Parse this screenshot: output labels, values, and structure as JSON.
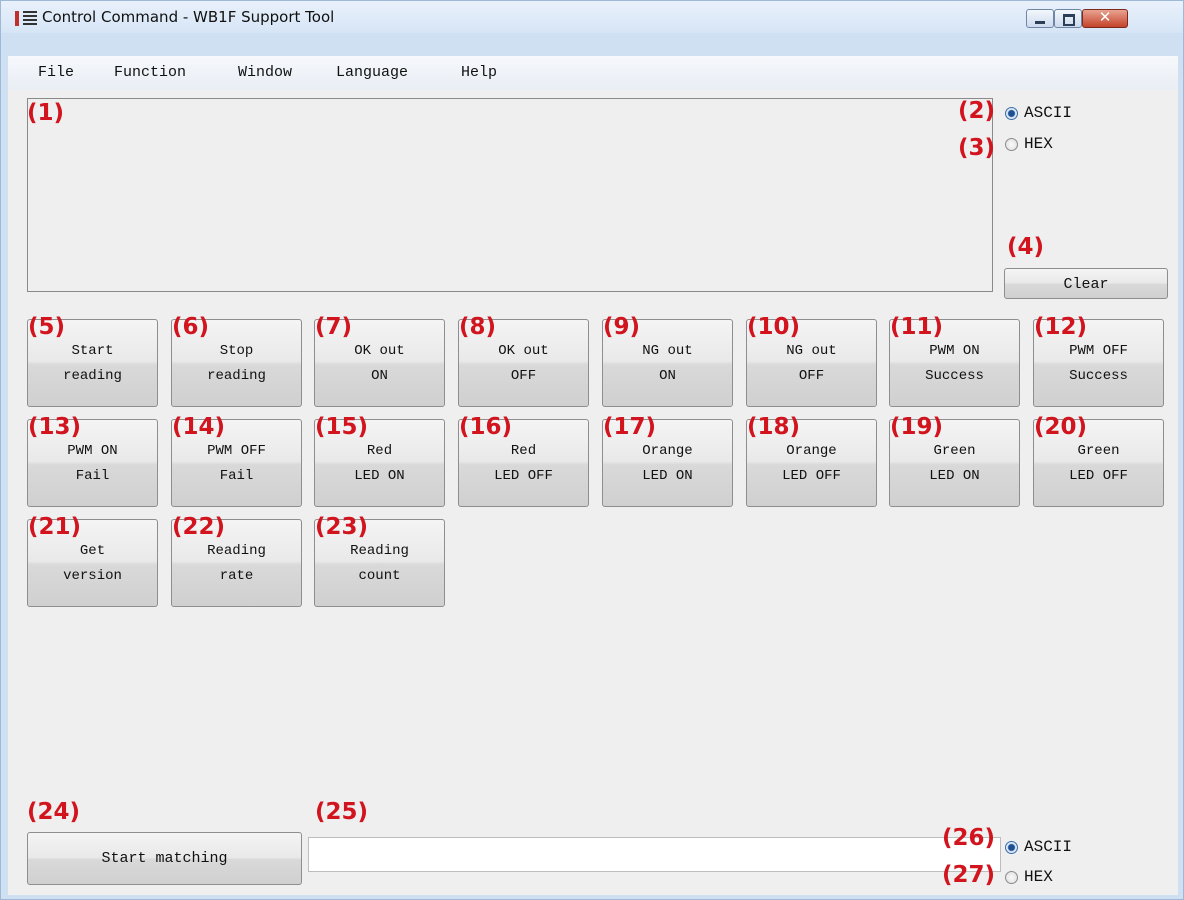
{
  "window": {
    "title": "Control Command - WB1F Support Tool",
    "icon": "app-icon",
    "controls": [
      "minimize-icon",
      "maximize-icon",
      "close-icon"
    ],
    "close_glyph": "✕"
  },
  "menu": [
    "File",
    "Function",
    "Window",
    "Language",
    "Help"
  ],
  "output": {
    "label": "(1)",
    "value": ""
  },
  "display_format": [
    {
      "label": "(2)",
      "text": "ASCII",
      "checked": true
    },
    {
      "label": "(3)",
      "text": "HEX",
      "checked": false
    }
  ],
  "clear": {
    "number": "(4)",
    "label": "Clear"
  },
  "commands": [
    {
      "number": "(5)",
      "line1": "Start",
      "line2": "reading"
    },
    {
      "number": "(6)",
      "line1": "Stop",
      "line2": "reading"
    },
    {
      "number": "(7)",
      "line1": "OK out",
      "line2": "ON"
    },
    {
      "number": "(8)",
      "line1": "OK out",
      "line2": "OFF"
    },
    {
      "number": "(9)",
      "line1": "NG out",
      "line2": "ON"
    },
    {
      "number": "(10)",
      "line1": "NG out",
      "line2": "OFF"
    },
    {
      "number": "(11)",
      "line1": "PWM ON",
      "line2": "Success"
    },
    {
      "number": "(12)",
      "line1": "PWM OFF",
      "line2": "Success"
    },
    {
      "number": "(13)",
      "line1": "PWM ON",
      "line2": "Fail"
    },
    {
      "number": "(14)",
      "line1": "PWM OFF",
      "line2": "Fail"
    },
    {
      "number": "(15)",
      "line1": "Red",
      "line2": "LED ON"
    },
    {
      "number": "(16)",
      "line1": "Red",
      "line2": "LED OFF"
    },
    {
      "number": "(17)",
      "line1": "Orange",
      "line2": "LED ON"
    },
    {
      "number": "(18)",
      "line1": "Orange",
      "line2": "LED OFF"
    },
    {
      "number": "(19)",
      "line1": "Green",
      "line2": "LED ON"
    },
    {
      "number": "(20)",
      "line1": "Green",
      "line2": "LED OFF"
    },
    {
      "number": "(21)",
      "line1": "Get",
      "line2": "version"
    },
    {
      "number": "(22)",
      "line1": "Reading",
      "line2": "rate"
    },
    {
      "number": "(23)",
      "line1": "Reading",
      "line2": "count"
    }
  ],
  "matching": {
    "number": "(24)",
    "label": "Start matching",
    "input_number": "(25)",
    "input_value": ""
  },
  "match_format": [
    {
      "label": "(26)",
      "text": "ASCII",
      "checked": true
    },
    {
      "label": "(27)",
      "text": "HEX",
      "checked": false
    }
  ],
  "annotation_color": "#d1141e"
}
